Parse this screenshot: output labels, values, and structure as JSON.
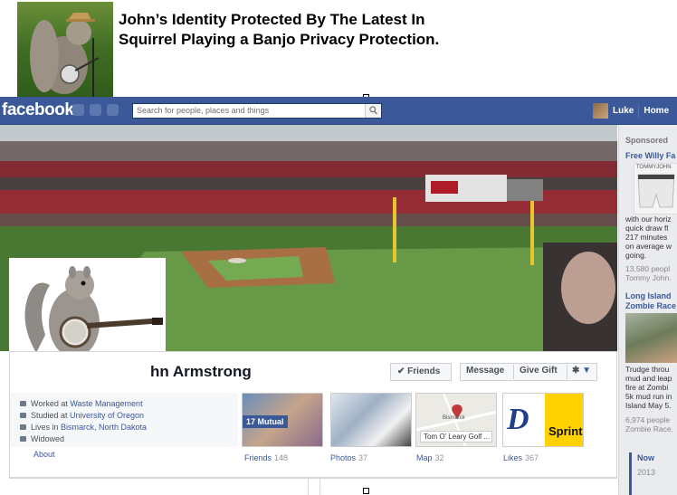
{
  "caption": {
    "title": "John’s Identity Protected By The Latest In Squirrel Playing a Banjo Privacy Protection."
  },
  "topbar": {
    "logo": "facebook",
    "search_placeholder": "Search for people, places and things",
    "user_name": "Luke",
    "home_label": "Home"
  },
  "profile": {
    "name": "hn Armstrong",
    "friends_button": "Friends",
    "message_button": "Message",
    "gift_button": "Give Gift",
    "about": {
      "worked_prefix": "Worked at ",
      "worked_link": "Waste Management",
      "studied_prefix": "Studied at ",
      "studied_link": "University of Oregon",
      "lives_prefix": "Lives in ",
      "lives_link": "Bismarck, North Dakota",
      "relationship": "Widowed",
      "about_link": "About"
    },
    "tiles": [
      {
        "label": "Friends",
        "count": "148",
        "badge": "17 Mutual"
      },
      {
        "label": "Photos",
        "count": "37"
      },
      {
        "label": "Map",
        "count": "32",
        "place": "Tom O' Leary Golf ...",
        "map_city": "Bismarck"
      },
      {
        "label": "Likes",
        "count": "367",
        "brand": "Sprint"
      }
    ]
  },
  "sidebar": {
    "sponsored": "Sponsored",
    "ad1": {
      "title": "Free Willy Fa",
      "brand": "TOMMYJOHN",
      "lines": [
        "with our horiz",
        "quick draw fl",
        "217 minutes",
        "on average w",
        "going."
      ],
      "meta": [
        "13,580 peopl",
        "Tommy John."
      ]
    },
    "ad2": {
      "title_lines": [
        "Long Island",
        "Zombie Race"
      ],
      "lines": [
        "Trudge throu",
        "mud and leap",
        "fire at Zombi",
        "5k mud run in",
        "Island May 5."
      ],
      "meta": [
        "6,974 people",
        "Zombie Race."
      ]
    },
    "timeline": {
      "now": "Now",
      "years": [
        "2013"
      ]
    }
  },
  "colors": {
    "facebook_blue": "#3b5998",
    "link": "#3b5998",
    "sprint_yellow": "#ffd200"
  }
}
